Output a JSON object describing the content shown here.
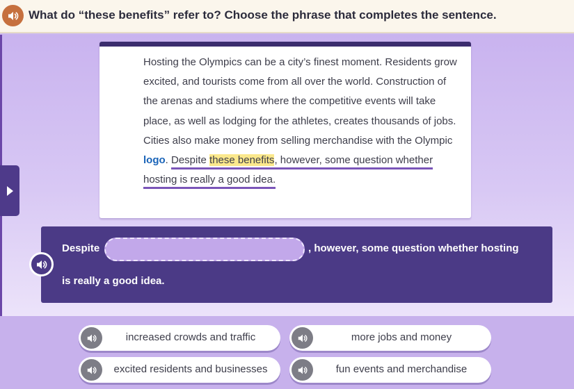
{
  "question": {
    "text": "What do “these benefits” refer to? Choose the phrase that completes the sentence.",
    "speaker_icon": "speaker-icon",
    "accent_color": "#c6703e"
  },
  "passage": {
    "seg1": "Hosting the Olympics can be a city’s finest moment. Residents grow excited, and tourists come from all over the world. Construction of the arenas and stadiums where the competitive events will take place, as well as lodging for the athletes, creates thousands of jobs. Cities also make money from selling merchandise with the Olympic ",
    "keyword": "logo",
    "seg2": ". ",
    "u_before": "Despite ",
    "highlight": "these benefits",
    "u_after": ", however, some question whether hosting is really a good idea."
  },
  "sentence": {
    "part1": "Despite",
    "part2": ", however, some question whether hosting",
    "part3": "is really a good idea.",
    "color": "#4b3a86"
  },
  "choices": [
    {
      "label": "increased crowds and traffic"
    },
    {
      "label": "more jobs and money"
    },
    {
      "label": "excited residents and businesses"
    },
    {
      "label": "fun events and merchandise"
    }
  ],
  "side_tab": {
    "icon": "triangle-right-icon"
  }
}
